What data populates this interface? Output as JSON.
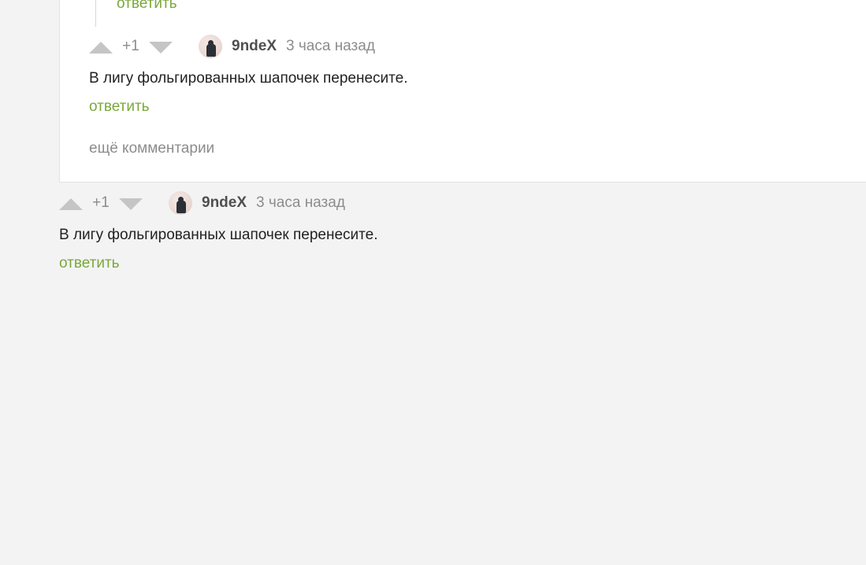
{
  "top_reply_label": "ответить",
  "nested_comment": {
    "rating": "+1",
    "username": "9ndeX",
    "time": "3 часа назад",
    "text": "В лигу фольгированных шапочек перенесите.",
    "reply_label": "ответить"
  },
  "more_comments_label": "ещё комментарии",
  "comment": {
    "rating": "+1",
    "username": "9ndeX",
    "time": "3 часа назад",
    "text": "В лигу фольгированных шапочек перенесите.",
    "reply_label": "ответить"
  },
  "icons": {
    "upvote": "triangle-up-icon",
    "downvote": "triangle-down-icon"
  },
  "colors": {
    "accent_green": "#7aa83c",
    "muted_gray": "#8c8c8c",
    "page_bg": "#f3f3f3"
  }
}
